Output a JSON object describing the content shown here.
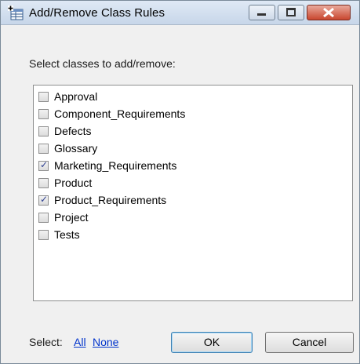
{
  "window": {
    "title": "Add/Remove Class Rules",
    "icon": "class-rules-icon"
  },
  "titlebar_buttons": [
    {
      "name": "minimize",
      "icon": "minimize-icon"
    },
    {
      "name": "maximize",
      "icon": "maximize-icon"
    },
    {
      "name": "close",
      "icon": "close-icon"
    }
  ],
  "instruction": "Select classes to add/remove:",
  "classes": [
    {
      "label": "Approval",
      "checked": false
    },
    {
      "label": "Component_Requirements",
      "checked": false
    },
    {
      "label": "Defects",
      "checked": false
    },
    {
      "label": "Glossary",
      "checked": false
    },
    {
      "label": "Marketing_Requirements",
      "checked": true
    },
    {
      "label": "Product",
      "checked": false
    },
    {
      "label": "Product_Requirements",
      "checked": true
    },
    {
      "label": "Project",
      "checked": false
    },
    {
      "label": "Tests",
      "checked": false
    }
  ],
  "footer": {
    "select_label": "Select:",
    "all_link": "All",
    "none_link": "None",
    "ok_label": "OK",
    "cancel_label": "Cancel"
  }
}
